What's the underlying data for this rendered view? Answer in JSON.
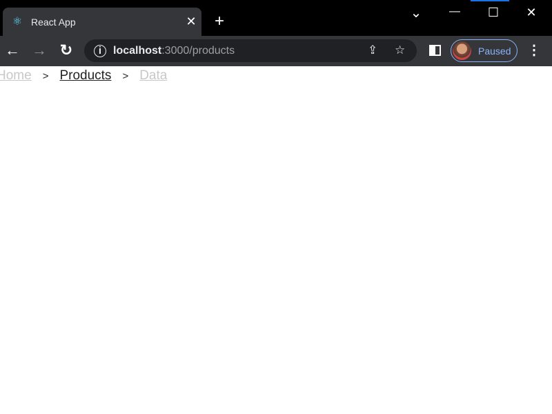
{
  "browser": {
    "tab": {
      "title": "React App",
      "favicon": "react-logo-icon",
      "close": "✕"
    },
    "new_tab": "+",
    "window_controls": {
      "tab_search": "⌄",
      "minimize": "—",
      "maximize": "☐",
      "close": "✕"
    },
    "nav": {
      "back": "←",
      "forward": "→",
      "reload": "↻"
    },
    "address": {
      "host": "localhost",
      "rest": ":3000/products",
      "info": "i"
    },
    "profile": {
      "status": "Paused"
    },
    "accent_color": "#8ab4f8"
  },
  "breadcrumb": {
    "items": [
      {
        "label": "Home",
        "state": "disabled"
      },
      {
        "label": "Products",
        "state": "current"
      },
      {
        "label": "Data",
        "state": "disabled"
      }
    ],
    "separator": ">"
  }
}
